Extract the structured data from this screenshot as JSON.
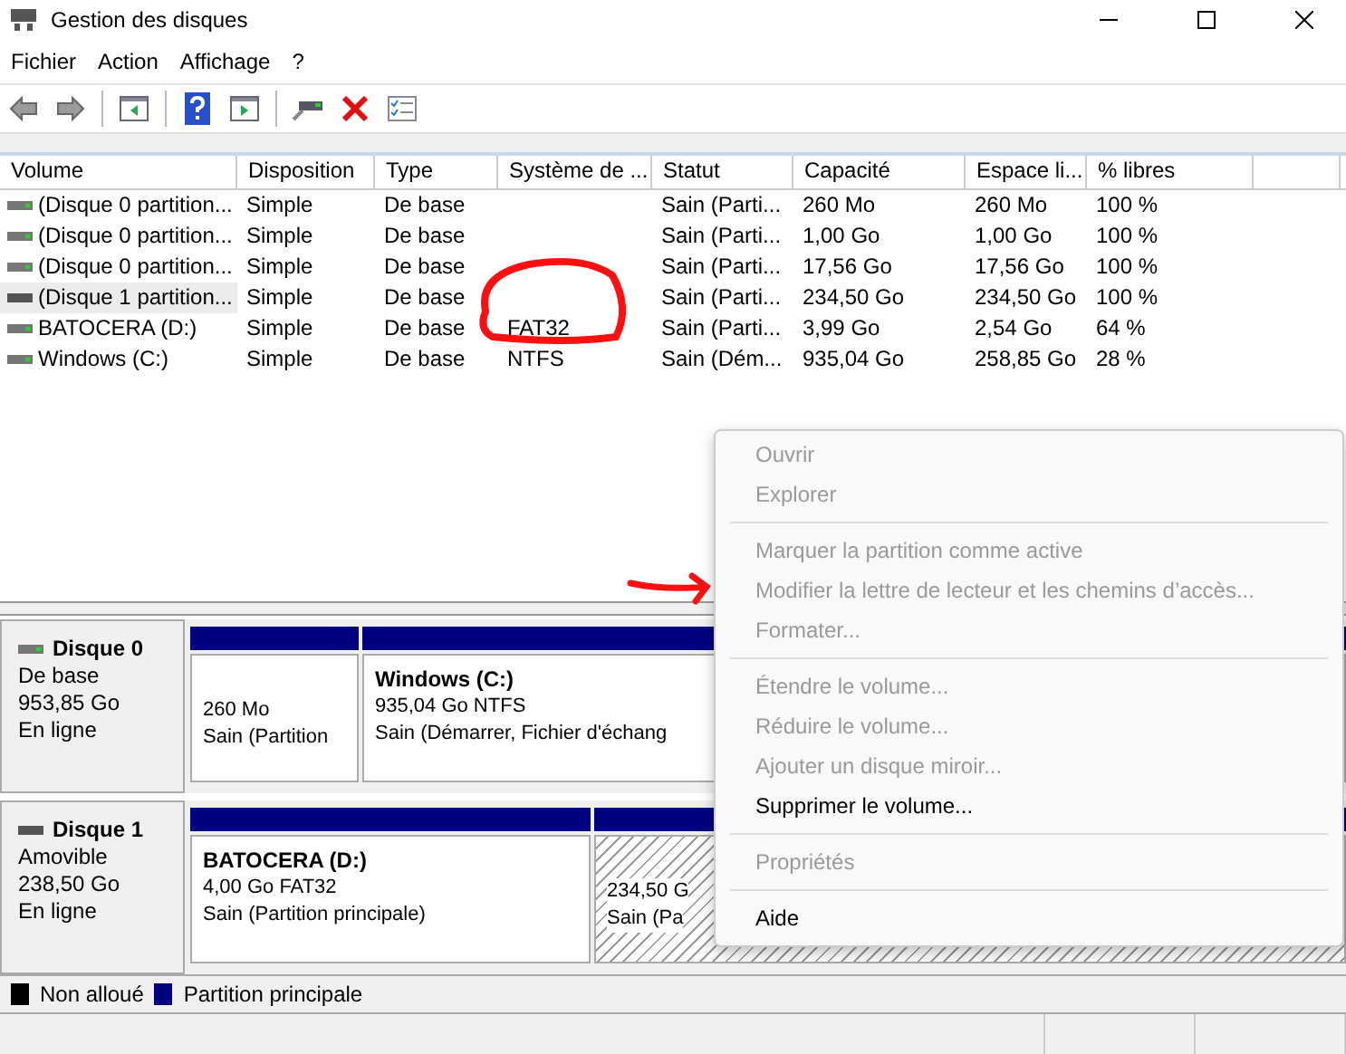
{
  "window": {
    "title": "Gestion des disques"
  },
  "menu_bar": [
    "Fichier",
    "Action",
    "Affichage",
    "?"
  ],
  "toolbar": [
    {
      "kind": "back",
      "disabled": true
    },
    {
      "kind": "forward",
      "disabled": true
    },
    {
      "kind": "panel",
      "disabled": false
    },
    {
      "kind": "help",
      "disabled": false
    },
    {
      "kind": "panel2",
      "disabled": false
    },
    {
      "kind": "connect",
      "disabled": false
    },
    {
      "kind": "delete",
      "disabled": false
    },
    {
      "kind": "checklist",
      "disabled": false
    }
  ],
  "table": {
    "columns": [
      "Volume",
      "Disposition",
      "Type",
      "Système de ...",
      "Statut",
      "Capacité",
      "Espace li...",
      "% libres"
    ],
    "rows": [
      {
        "selected": false,
        "cells": [
          "(Disque 0 partition...",
          "Simple",
          "De base",
          "",
          "Sain (Parti...",
          "260 Mo",
          "260 Mo",
          "100 %"
        ]
      },
      {
        "selected": false,
        "cells": [
          "(Disque 0 partition...",
          "Simple",
          "De base",
          "",
          "Sain (Parti...",
          "1,00 Go",
          "1,00 Go",
          "100 %"
        ]
      },
      {
        "selected": false,
        "cells": [
          "(Disque 0 partition...",
          "Simple",
          "De base",
          "",
          "Sain (Parti...",
          "17,56 Go",
          "17,56 Go",
          "100 %"
        ]
      },
      {
        "selected": true,
        "cells": [
          "(Disque 1 partition...",
          "Simple",
          "De base",
          "",
          "Sain (Parti...",
          "234,50 Go",
          "234,50 Go",
          "100 %"
        ]
      },
      {
        "selected": false,
        "cells": [
          "BATOCERA (D:)",
          "Simple",
          "De base",
          "FAT32",
          "Sain (Parti...",
          "3,99 Go",
          "2,54 Go",
          "64 %"
        ]
      },
      {
        "selected": false,
        "cells": [
          "Windows (C:)",
          "Simple",
          "De base",
          "NTFS",
          "Sain (Dém...",
          "935,04 Go",
          "258,85 Go",
          "28 %"
        ]
      }
    ]
  },
  "disks": [
    {
      "name": "Disque 0",
      "lines": [
        "De base",
        "953,85 Go",
        "En ligne"
      ],
      "partitions": [
        {
          "kind": "primary",
          "lines": [
            "260 Mo",
            "Sain (Partition"
          ]
        },
        {
          "kind": "primary",
          "name": "Windows  (C:)",
          "lines": [
            "935,04 Go NTFS",
            "Sain (Démarrer, Fichier d'échang"
          ]
        }
      ]
    },
    {
      "name": "Disque 1",
      "lines": [
        "Amovible",
        "238,50 Go",
        "En ligne"
      ],
      "partitions": [
        {
          "kind": "primary",
          "name": "BATOCERA  (D:)",
          "lines": [
            "4,00 Go FAT32",
            "Sain (Partition principale)"
          ]
        },
        {
          "kind": "unallocated_primary",
          "lines": [
            "234,50 G",
            "Sain (Pa"
          ]
        }
      ]
    }
  ],
  "legend": [
    {
      "label": "Non alloué",
      "color": "#000000"
    },
    {
      "label": "Partition principale",
      "color": "#000080"
    }
  ],
  "context_menu": [
    [
      {
        "label": "Ouvrir",
        "disabled": true
      },
      {
        "label": "Explorer",
        "disabled": true
      }
    ],
    [
      {
        "label": "Marquer la partition comme active",
        "disabled": true
      },
      {
        "label": "Modifier la lettre de lecteur et les chemins d’accès...",
        "disabled": true
      },
      {
        "label": "Formater...",
        "disabled": true
      }
    ],
    [
      {
        "label": "Étendre le volume...",
        "disabled": true
      },
      {
        "label": "Réduire le volume...",
        "disabled": true
      },
      {
        "label": "Ajouter un disque miroir...",
        "disabled": true
      },
      {
        "label": "Supprimer le volume...",
        "disabled": false
      }
    ],
    [
      {
        "label": "Propriétés",
        "disabled": true
      }
    ],
    [
      {
        "label": "Aide",
        "disabled": false
      }
    ]
  ]
}
